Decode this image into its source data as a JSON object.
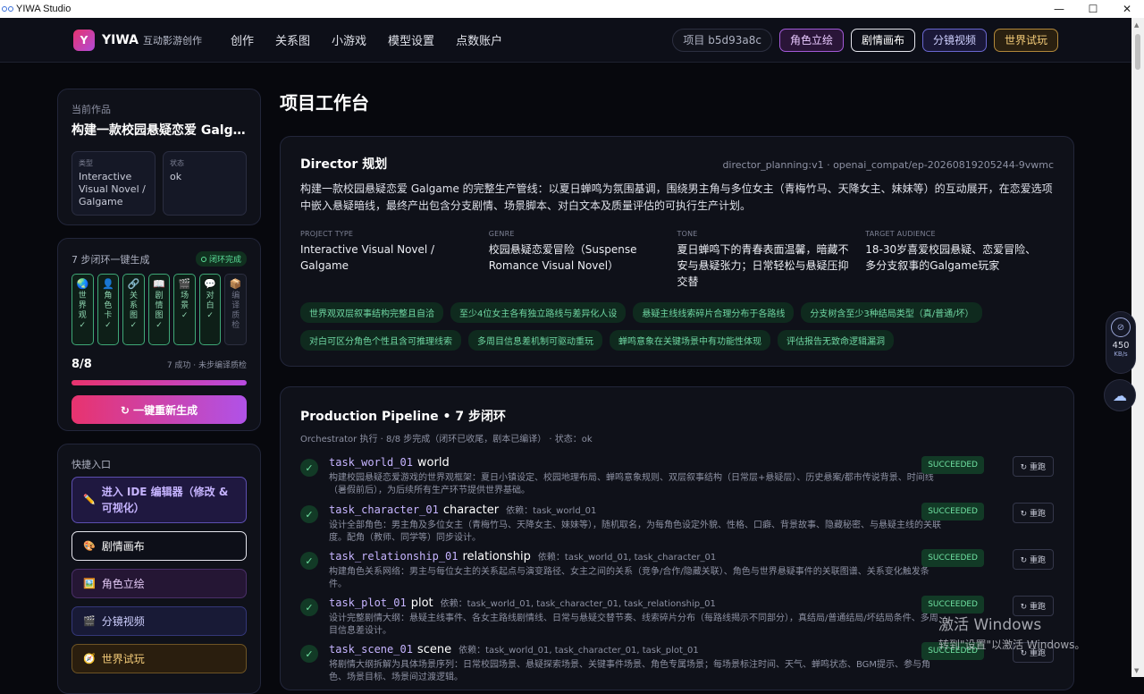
{
  "window": {
    "title": "YIWA Studio",
    "min": "—",
    "max": "☐",
    "close": "✕"
  },
  "nav": {
    "logo_letter": "Y",
    "brand": "YIWA",
    "brand_sub": "互动影游创作",
    "links": [
      "创作",
      "关系图",
      "小游戏",
      "模型设置",
      "点数账户"
    ],
    "project_pill": "项目 b5d93a8c",
    "pills": [
      "角色立绘",
      "剧情画布",
      "分镜视频",
      "世界试玩"
    ]
  },
  "current": {
    "label": "当前作品",
    "name": "构建一款校园悬疑恋爱 Galgame 的完整生产管线",
    "type_key": "类型",
    "type_val": "Interactive Visual Novel / Galgame",
    "status_key": "状态",
    "status_val": "ok"
  },
  "steps": {
    "title": "7 步闭环一键生成",
    "badge": "闭环完成",
    "items": [
      {
        "icon": "🌏",
        "label": "世界观",
        "done": true
      },
      {
        "icon": "👤",
        "label": "角色卡",
        "done": true
      },
      {
        "icon": "🔗",
        "label": "关系图",
        "done": true
      },
      {
        "icon": "📖",
        "label": "剧情图",
        "done": true
      },
      {
        "icon": "🎬",
        "label": "场景",
        "done": true
      },
      {
        "icon": "💬",
        "label": "对白",
        "done": true
      },
      {
        "icon": "📦",
        "label": "编译质检",
        "done": false
      }
    ],
    "check": "✓",
    "count": "8/8",
    "count_desc": "7 成功 · 未步编译质检",
    "progress": 1.0,
    "regen_button": "↻ 一键重新生成"
  },
  "quick": {
    "title": "快捷入口",
    "ide": "进入 IDE 编辑器（修改 & 可视化）",
    "story": "剧情画布",
    "char": "角色立绘",
    "video": "分镜视频",
    "world": "世界试玩"
  },
  "main": {
    "page_title": "项目工作台",
    "director": {
      "title": "Director 规划",
      "source": "director_planning:v1 · openai_compat/ep-20260819205244-9vwmc",
      "desc": "构建一款校园悬疑恋爱 Galgame 的完整生产管线：以夏日蝉鸣为氛围基调，围绕男主角与多位女主（青梅竹马、天降女主、妹妹等）的互动展开，在恋爱选项中嵌入悬疑暗线，最终产出包含分支剧情、场景脚本、对白文本及质量评估的可执行生产计划。",
      "fields": [
        {
          "k": "PROJECT TYPE",
          "v": "Interactive Visual Novel / Galgame"
        },
        {
          "k": "GENRE",
          "v": "校园悬疑恋爱冒险（Suspense Romance Visual Novel）"
        },
        {
          "k": "TONE",
          "v": "夏日蝉鸣下的青春表面温馨，暗藏不安与悬疑张力；日常轻松与悬疑压抑交替"
        },
        {
          "k": "TARGET AUDIENCE",
          "v": "18-30岁喜爱校园悬疑、恋爱冒险、多分支叙事的Galgame玩家"
        }
      ],
      "tags": [
        "世界观双层叙事结构完整且自洽",
        "至少4位女主各有独立路线与差异化人设",
        "悬疑主线线索碎片合理分布于各路线",
        "分支树含至少3种结局类型（真/普通/坏）",
        "对白可区分角色个性且含可推理线索",
        "多周目信息差机制可驱动重玩",
        "蝉鸣意象在关键场景中有功能性体现",
        "评估报告无致命逻辑漏洞"
      ]
    },
    "pipeline": {
      "title": "Production Pipeline • 7 步闭环",
      "sub": "Orchestrator 执行 · 8/8 步完成（闭环已收尾，剧本已编译） · 状态：ok",
      "status_label": "SUCCEEDED",
      "rerun_label": "↻ 重跑",
      "tasks": [
        {
          "id": "task_world_01",
          "kind": "world",
          "deps": "",
          "desc": "构建校园悬疑恋爱游戏的世界观框架：夏日小镇设定、校园地理布局、蝉鸣意象规则、双层叙事结构（日常层+悬疑层）、历史悬案/都市传说背景、时间线（暑假前后），为后续所有生产环节提供世界基础。"
        },
        {
          "id": "task_character_01",
          "kind": "character",
          "deps": "依赖：task_world_01",
          "desc": "设计全部角色：男主角及多位女主（青梅竹马、天降女主、妹妹等），随机取名，为每角色设定外貌、性格、口癖、背景故事、隐藏秘密、与悬疑主线的关联度。配角（教师、同学等）同步设计。"
        },
        {
          "id": "task_relationship_01",
          "kind": "relationship",
          "deps": "依赖：task_world_01, task_character_01",
          "desc": "构建角色关系网络：男主与每位女主的关系起点与演变路径、女主之间的关系（竞争/合作/隐藏关联）、角色与世界悬疑事件的关联图谱、关系变化触发条件。"
        },
        {
          "id": "task_plot_01",
          "kind": "plot",
          "deps": "依赖：task_world_01, task_character_01, task_relationship_01",
          "desc": "设计完整剧情大纲：悬疑主线事件、各女主路线剧情线、日常与悬疑交替节奏、线索碎片分布（每路线揭示不同部分），真结局/普通结局/坏结局条件、多周目信息差设计。"
        },
        {
          "id": "task_scene_01",
          "kind": "scene",
          "deps": "依赖：task_world_01, task_character_01, task_plot_01",
          "desc": "将剧情大纲拆解为具体场景序列：日常校园场景、悬疑探索场景、关键事件场景、角色专属场景；每场景标注时间、天气、蝉鸣状态、BGM提示、参与角色、场景目标、场景间过渡逻辑。"
        }
      ]
    }
  },
  "speed": {
    "value": "450",
    "unit": "KB/s",
    "icon": "⊘"
  },
  "cloud_icon": "☁",
  "watermark": {
    "line1": "激活 Windows",
    "line2": "转到\"设置\"以激活 Windows。"
  }
}
